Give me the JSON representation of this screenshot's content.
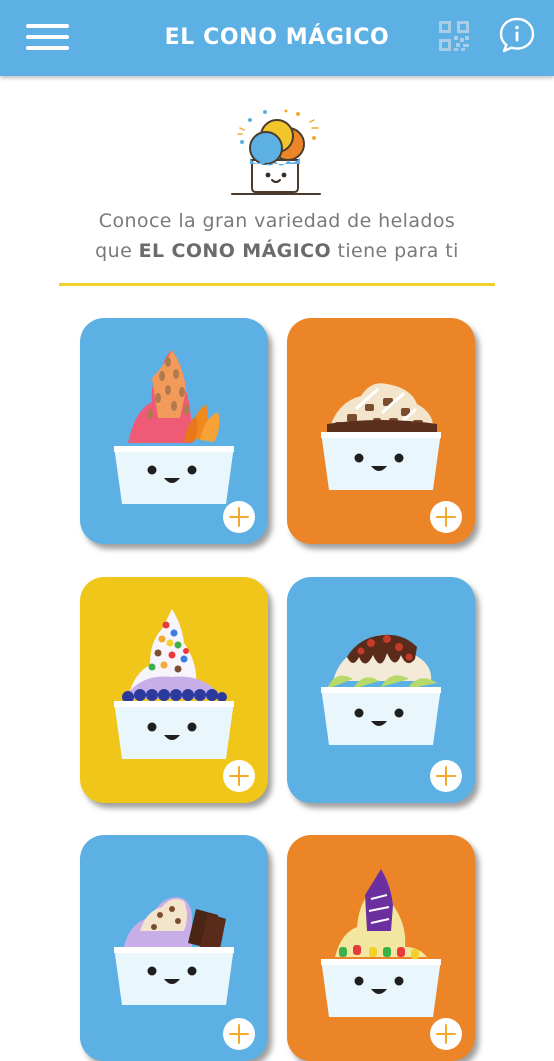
{
  "header": {
    "title": "EL CONO MÁGICO",
    "menu_icon": "hamburger-menu-icon",
    "qr_icon": "qr-code-icon",
    "info_icon": "info-chat-icon"
  },
  "intro": {
    "line1": "Conoce la gran variedad de helados",
    "line2_prefix": "que ",
    "line2_brand": "EL CONO MÁGICO",
    "line2_suffix": " tiene para ti"
  },
  "colors": {
    "header": "#5cb0e3",
    "blue": "#5cb0e3",
    "orange": "#ec8528",
    "yellow": "#f1c61a",
    "divider": "#f2d22a"
  },
  "products": [
    {
      "color": "#5cb0e3",
      "icon": "strawberry-almond-peach-icecream-icon"
    },
    {
      "color": "#ec8528",
      "icon": "chocolate-nut-icecream-icon"
    },
    {
      "color": "#f1c61a",
      "icon": "candy-blueberry-icecream-icon"
    },
    {
      "color": "#5cb0e3",
      "icon": "chocolate-lime-icecream-icon"
    },
    {
      "color": "#5cb0e3",
      "icon": "cookie-chocolate-bar-icecream-icon"
    },
    {
      "color": "#ec8528",
      "icon": "gummy-bear-berry-icecream-icon"
    }
  ]
}
